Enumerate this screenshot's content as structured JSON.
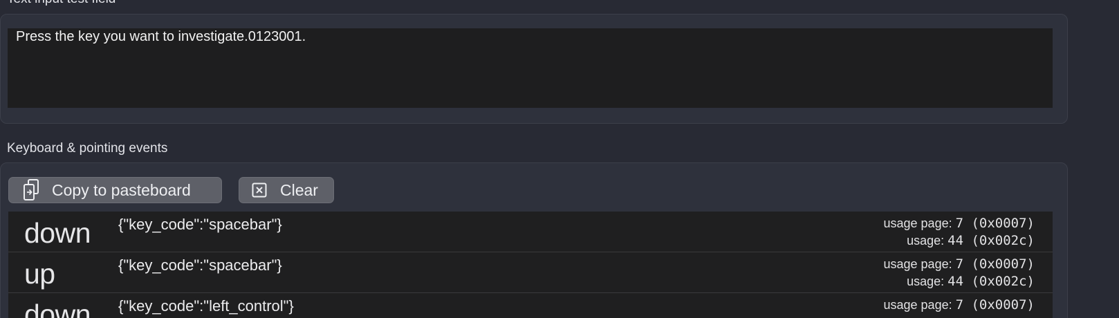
{
  "text_input": {
    "title": "Text input test field",
    "value": "Press the key you want to investigate.0123001."
  },
  "events": {
    "title": "Keyboard & pointing events",
    "copy_label": "Copy to pasteboard",
    "clear_label": "Clear",
    "usage_page_label": "usage page:",
    "usage_label": "usage:",
    "rows": [
      {
        "type": "down",
        "json": "{\"key_code\":\"spacebar\"}",
        "usage_page": "7 (0x0007)",
        "usage": "44 (0x002c)"
      },
      {
        "type": "up",
        "json": "{\"key_code\":\"spacebar\"}",
        "usage_page": "7 (0x0007)",
        "usage": "44 (0x002c)"
      },
      {
        "type": "down",
        "json": "{\"key_code\":\"left_control\"}",
        "usage_page": "7 (0x0007)",
        "usage": ""
      }
    ]
  },
  "colors": {
    "background": "#282a34",
    "panel": "#2e313c",
    "field": "#1e1e1f",
    "button": "#5e6068"
  }
}
